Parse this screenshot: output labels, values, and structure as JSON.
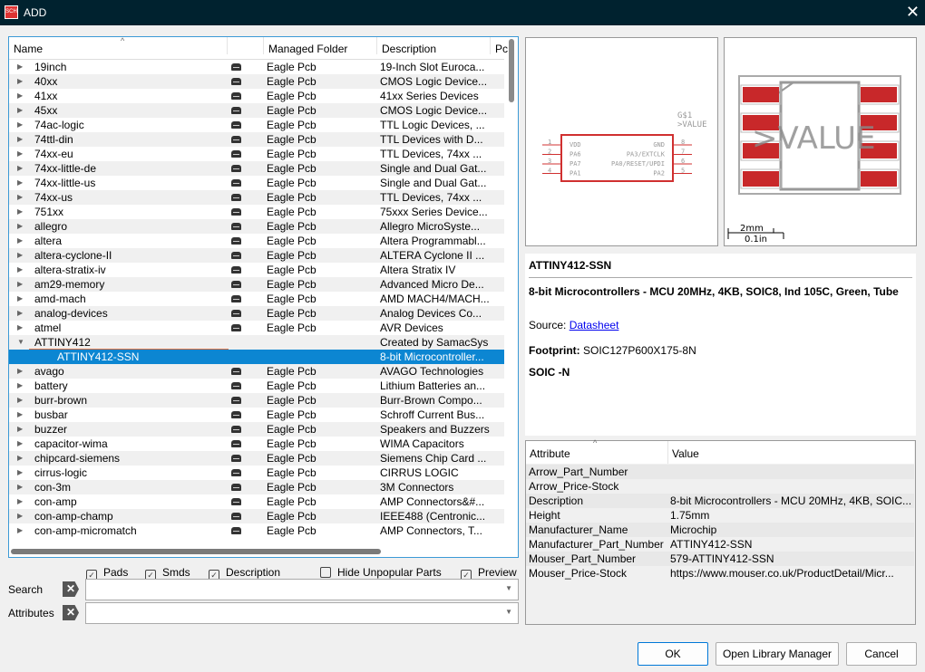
{
  "window": {
    "title": "ADD",
    "app_icon": "SCH"
  },
  "list": {
    "columns": [
      "Name",
      "",
      "Managed Folder",
      "Description",
      "Pc"
    ],
    "rows": [
      {
        "name": "19inch",
        "folder": "Eagle Pcb",
        "desc": "19-Inch Slot Euroca...",
        "lock": true
      },
      {
        "name": "40xx",
        "folder": "Eagle Pcb",
        "desc": "CMOS Logic Device...",
        "lock": true
      },
      {
        "name": "41xx",
        "folder": "Eagle Pcb",
        "desc": "41xx Series Devices",
        "lock": true
      },
      {
        "name": "45xx",
        "folder": "Eagle Pcb",
        "desc": "CMOS Logic Device...",
        "lock": true
      },
      {
        "name": "74ac-logic",
        "folder": "Eagle Pcb",
        "desc": "TTL Logic Devices, ...",
        "lock": true
      },
      {
        "name": "74ttl-din",
        "folder": "Eagle Pcb",
        "desc": "TTL Devices with D...",
        "lock": true
      },
      {
        "name": "74xx-eu",
        "folder": "Eagle Pcb",
        "desc": "TTL Devices, 74xx ...",
        "lock": true
      },
      {
        "name": "74xx-little-de",
        "folder": "Eagle Pcb",
        "desc": "Single and Dual Gat...",
        "lock": true
      },
      {
        "name": "74xx-little-us",
        "folder": "Eagle Pcb",
        "desc": "Single and Dual Gat...",
        "lock": true
      },
      {
        "name": "74xx-us",
        "folder": "Eagle Pcb",
        "desc": "TTL Devices, 74xx ...",
        "lock": true
      },
      {
        "name": "751xx",
        "folder": "Eagle Pcb",
        "desc": "75xxx Series Device...",
        "lock": true
      },
      {
        "name": "allegro",
        "folder": "Eagle Pcb",
        "desc": "Allegro MicroSyste...",
        "lock": true
      },
      {
        "name": "altera",
        "folder": "Eagle Pcb",
        "desc": "Altera Programmabl...",
        "lock": true
      },
      {
        "name": "altera-cyclone-II",
        "folder": "Eagle Pcb",
        "desc": "ALTERA Cyclone II ...",
        "lock": true
      },
      {
        "name": "altera-stratix-iv",
        "folder": "Eagle Pcb",
        "desc": "Altera Stratix IV",
        "lock": true
      },
      {
        "name": "am29-memory",
        "folder": "Eagle Pcb",
        "desc": "Advanced Micro De...",
        "lock": true
      },
      {
        "name": "amd-mach",
        "folder": "Eagle Pcb",
        "desc": "AMD MACH4/MACH...",
        "lock": true
      },
      {
        "name": "analog-devices",
        "folder": "Eagle Pcb",
        "desc": "Analog Devices Co...",
        "lock": true
      },
      {
        "name": "atmel",
        "folder": "Eagle Pcb",
        "desc": "AVR Devices",
        "lock": true
      },
      {
        "name": "ATTINY412",
        "folder": "",
        "desc": "Created by SamacSys",
        "lock": false,
        "expanded": true
      },
      {
        "name": "ATTINY412-SSN",
        "folder": "",
        "desc": "8-bit Microcontroller...",
        "lock": false,
        "child": true,
        "selected": true
      },
      {
        "name": "avago",
        "folder": "Eagle Pcb",
        "desc": "AVAGO Technologies",
        "lock": true
      },
      {
        "name": "battery",
        "folder": "Eagle Pcb",
        "desc": "Lithium Batteries an...",
        "lock": true
      },
      {
        "name": "burr-brown",
        "folder": "Eagle Pcb",
        "desc": "Burr-Brown Compo...",
        "lock": true
      },
      {
        "name": "busbar",
        "folder": "Eagle Pcb",
        "desc": "Schroff Current Bus...",
        "lock": true
      },
      {
        "name": "buzzer",
        "folder": "Eagle Pcb",
        "desc": "Speakers and Buzzers",
        "lock": true
      },
      {
        "name": "capacitor-wima",
        "folder": "Eagle Pcb",
        "desc": "WIMA Capacitors",
        "lock": true
      },
      {
        "name": "chipcard-siemens",
        "folder": "Eagle Pcb",
        "desc": "Siemens Chip Card ...",
        "lock": true
      },
      {
        "name": "cirrus-logic",
        "folder": "Eagle Pcb",
        "desc": "CIRRUS LOGIC",
        "lock": true
      },
      {
        "name": "con-3m",
        "folder": "Eagle Pcb",
        "desc": "3M Connectors",
        "lock": true
      },
      {
        "name": "con-amp",
        "folder": "Eagle Pcb",
        "desc": "AMP Connectors&#...",
        "lock": true
      },
      {
        "name": "con-amp-champ",
        "folder": "Eagle Pcb",
        "desc": "IEEE488 (Centronic...",
        "lock": true
      },
      {
        "name": "con-amp-micromatch",
        "folder": "Eagle Pcb",
        "desc": "AMP Connectors, T...",
        "lock": true
      }
    ]
  },
  "filters": {
    "pads": "Pads",
    "smds": "Smds",
    "description": "Description",
    "hide_unpopular": "Hide Unpopular Parts",
    "preview": "Preview",
    "pads_checked": true,
    "smds_checked": true,
    "description_checked": true,
    "hide_unpopular_checked": false,
    "preview_checked": true
  },
  "search": {
    "label": "Search",
    "value": ""
  },
  "attributes_filter": {
    "label": "Attributes",
    "value": ""
  },
  "schematic": {
    "name": "G$1",
    "value": ">VALUE",
    "pins_left": [
      {
        "num": "1",
        "name": "VDD"
      },
      {
        "num": "2",
        "name": "PA6"
      },
      {
        "num": "3",
        "name": "PA7"
      },
      {
        "num": "4",
        "name": "PA1"
      }
    ],
    "pins_right": [
      {
        "num": "8",
        "name": "GND"
      },
      {
        "num": "7",
        "name": "PA3/EXTCLK"
      },
      {
        "num": "6",
        "name": "PA0/RESET/UPDI"
      },
      {
        "num": "5",
        "name": "PA2"
      }
    ]
  },
  "footprint": {
    "value_text": ">VALUE",
    "scale_mm": "2mm",
    "scale_in": "0.1in"
  },
  "info": {
    "title": "ATTINY412-SSN",
    "description": "8-bit Microcontrollers - MCU 20MHz, 4KB, SOIC8, Ind 105C, Green, Tube",
    "source_label": "Source:",
    "source_link": "Datasheet",
    "footprint_label": "Footprint:",
    "footprint_value": "SOIC127P600X175-8N",
    "package": "SOIC -N"
  },
  "attribute_table": {
    "columns": [
      "Attribute",
      "Value"
    ],
    "rows": [
      [
        "Arrow_Part_Number",
        ""
      ],
      [
        "Arrow_Price-Stock",
        ""
      ],
      [
        "Description",
        "8-bit Microcontrollers - MCU 20MHz, 4KB, SOIC..."
      ],
      [
        "Height",
        "1.75mm"
      ],
      [
        "Manufacturer_Name",
        "Microchip"
      ],
      [
        "Manufacturer_Part_Number",
        "ATTINY412-SSN"
      ],
      [
        "Mouser_Part_Number",
        "579-ATTINY412-SSN"
      ],
      [
        "Mouser_Price-Stock",
        "https://www.mouser.co.uk/ProductDetail/Micr..."
      ]
    ]
  },
  "buttons": {
    "ok": "OK",
    "open_library_manager": "Open Library Manager",
    "cancel": "Cancel"
  },
  "colors": {
    "titlebar": "#00222f",
    "selection": "#0c86d2",
    "schematic_red": "#d03030",
    "pad_red": "#c8282a"
  }
}
